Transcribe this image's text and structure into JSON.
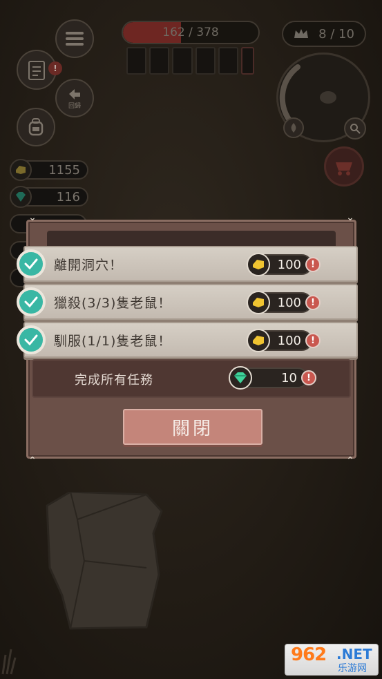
{
  "hud": {
    "health": {
      "text": "162 / 378",
      "fraction": 0.43
    },
    "counter": {
      "text": "8 / 10",
      "icon": "crown-icon"
    },
    "return_label": "回歸",
    "gold": "1155",
    "gems": "116"
  },
  "dialog": {
    "quests": [
      {
        "text": "離開洞穴！",
        "reward": "100",
        "reward_icon": "gold-coin-icon",
        "completed": true
      },
      {
        "text": "獵殺(3/3)隻老鼠！",
        "reward": "100",
        "reward_icon": "gold-coin-icon",
        "completed": true
      },
      {
        "text": "馴服(1/1)隻老鼠！",
        "reward": "100",
        "reward_icon": "gold-coin-icon",
        "completed": true
      }
    ],
    "all_tasks": {
      "text": "完成所有任務",
      "reward": "10",
      "reward_icon": "gem-icon"
    },
    "close_label": "關閉",
    "badge": "!"
  },
  "watermark": {
    "digits": "962",
    "net": ".NET",
    "sub": "乐游网"
  },
  "colors": {
    "check": "#39b7a4",
    "badge": "#c9574f",
    "close_button": "#c4857a",
    "panel": "#6b5048"
  }
}
